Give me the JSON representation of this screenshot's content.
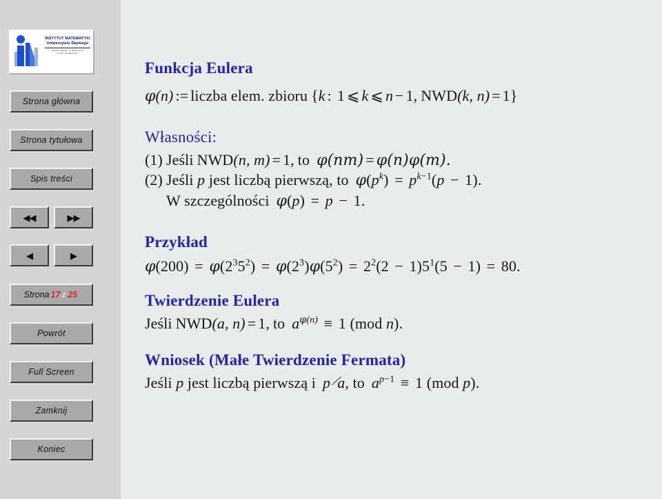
{
  "sidebar": {
    "logo": {
      "line1": "INSTYTUT MATEMATYKI",
      "line2": "Uniwersytetu Śląskiego",
      "line3": "40-007 Katowice, ul. Bankowa 14",
      "line4": "tel./fax: 32 258 29 76"
    },
    "buttons": {
      "home": "Strona główna",
      "title_page": "Strona tytułowa",
      "contents": "Spis treści",
      "first": "◀◀",
      "last": "▶▶",
      "prev": "◀",
      "next": "▶",
      "back": "Powrót",
      "fullscreen": "Full Screen",
      "close": "Zamknij",
      "end": "Koniec"
    },
    "page_indicator": {
      "word": "Strona",
      "current": "17",
      "separator": "z",
      "total": "25"
    }
  },
  "content": {
    "title": "Funkcja Eulera",
    "definition": {
      "lhs_phi": "φ",
      "lhs_arg": "(n)",
      "assign": ":=",
      "text": "liczba elem. zbioru",
      "set_open": "{",
      "set_var": "k",
      "colon": ":",
      "lower": "1",
      "le1": "⩽",
      "var": "k",
      "le2": "⩽",
      "upper_n": "n",
      "minus": "−",
      "upper_one": "1",
      "comma": ",",
      "nwd": "NWD",
      "nwd_args": "(k, n)",
      "eq": "=",
      "rhs": "1",
      "set_close": "}"
    },
    "properties_heading": "Własności:",
    "property1": {
      "number": "(1)",
      "text_if": "Jeśli",
      "nwd": "NWD",
      "args": "(n, m)",
      "eq": "=",
      "one": "1,",
      "then": "to",
      "result_lhs": "φ(nm)",
      "result_eq": "=",
      "result_rhs": "φ(n)φ(m)."
    },
    "property2": {
      "number": "(2)",
      "text": "Jeśli p jest liczbą pierwszą, to",
      "result": "φ(p^k) = p^{k−1}(p − 1)."
    },
    "property2b": {
      "text": "W szczególności",
      "result": "φ(p) = p − 1."
    },
    "example_heading": "Przykład",
    "example_line": "φ(200) = φ(2³5²) = φ(2³)φ(5²) = 2²(2 − 1)5¹(5 − 1) = 80.",
    "euler_theorem": {
      "heading": "Twierdzenie Eulera",
      "text_if": "Jeśli",
      "nwd": "NWD",
      "args": "(a, n)",
      "eq": "=",
      "one": "1,",
      "then": "to",
      "congruence": "a^{φ(n)} ≡ 1 (mod n)."
    },
    "fermat_corollary": {
      "heading": "Wniosek (Małe Twierdzenie Fermata)",
      "text": "Jeśli p jest liczbą pierwszą i  p ∤ a, to",
      "congruence": "a^{p−1} ≡ 1 (mod p)."
    }
  },
  "colors": {
    "sidebar_bg": "#d5d5d5",
    "content_bg": "#e8ecea",
    "heading_blue": "#2222b4",
    "page_red": "#d22b2b",
    "button_face": "#a9a9a9",
    "logo_blue": "#16216b"
  }
}
